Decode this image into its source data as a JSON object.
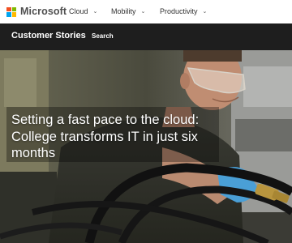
{
  "brand": {
    "name": "Microsoft",
    "logo_colors": [
      "#f25022",
      "#7fba00",
      "#00a4ef",
      "#ffb900"
    ]
  },
  "topnav": {
    "items": [
      {
        "label": "Cloud",
        "icon": "chevron-down-icon"
      },
      {
        "label": "Mobility",
        "icon": "chevron-down-icon"
      },
      {
        "label": "Productivity",
        "icon": "chevron-down-icon"
      }
    ]
  },
  "subnav": {
    "title": "Customer Stories",
    "search_label": "Search",
    "background": "#1e1e1e"
  },
  "hero": {
    "headline": "Setting a fast pace to the cloud: College transforms IT in just six months"
  }
}
